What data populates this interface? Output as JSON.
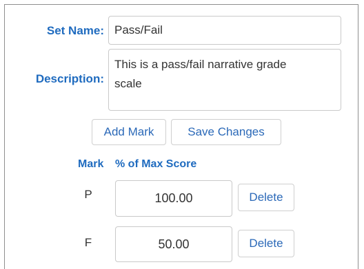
{
  "form": {
    "set_name_label": "Set Name:",
    "set_name_value": "Pass/Fail",
    "description_label": "Description:",
    "description_value": "This is a pass/fail narrative grade scale"
  },
  "toolbar": {
    "add_mark_label": "Add Mark",
    "save_changes_label": "Save Changes"
  },
  "table": {
    "headers": [
      "Mark",
      "% of Max Score"
    ],
    "rows": [
      {
        "mark": "P",
        "score": "100.00",
        "delete_label": "Delete"
      },
      {
        "mark": "F",
        "score": "50.00",
        "delete_label": "Delete"
      }
    ]
  },
  "colors": {
    "label_blue": "#1f6bbf",
    "button_text": "#2b69b8",
    "border": "#c9c9c9"
  }
}
